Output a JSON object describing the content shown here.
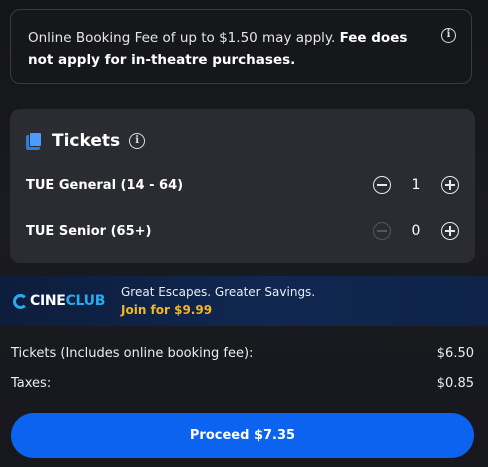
{
  "fee_notice": {
    "text_regular": "Online Booking Fee of up to $1.50 may apply. ",
    "text_bold": "Fee does not apply for in-theatre purchases.",
    "info_icon": "info-icon"
  },
  "tickets": {
    "title": "Tickets",
    "title_icon": "ticket-icon",
    "info_icon": "info-icon",
    "rows": [
      {
        "label": "TUE General (14 - 64)",
        "quantity": "1",
        "decrement_enabled": true
      },
      {
        "label": "TUE Senior (65+)",
        "quantity": "0",
        "decrement_enabled": false
      }
    ]
  },
  "cineclub": {
    "logo_cine": "CINE",
    "logo_club": "CLUB",
    "tagline": "Great Escapes. Greater Savings.",
    "join_label": "Join for $9.99",
    "colors": {
      "brand_blue": "#29a9f0",
      "join_gold": "#f5b71b"
    }
  },
  "summary": {
    "tickets_label": "Tickets (Includes online booking fee):",
    "tickets_value": "$6.50",
    "taxes_label": "Taxes:",
    "taxes_value": "$0.85"
  },
  "proceed_button": {
    "label": "Proceed $7.35",
    "color": "#0b63f0"
  }
}
